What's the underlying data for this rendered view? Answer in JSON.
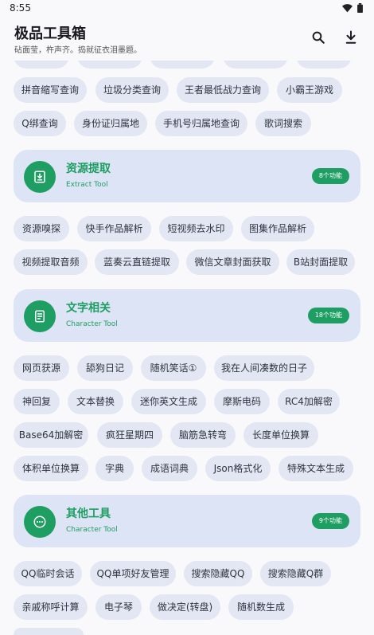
{
  "status": {
    "time": "8:55"
  },
  "app": {
    "title": "极品工具箱",
    "subtitle": "砧面莹，杵声齐。捣就征衣泪墨题。"
  },
  "colors": {
    "accent": "#1e9e62",
    "card_bg": "#dde4f6",
    "chip_bg": "#e3e7f3"
  },
  "sections": {
    "search": {
      "items": [
        "拼音缩写查询",
        "垃圾分类查询",
        "王者最低战力查询",
        "小霸王游戏",
        "Q绑查询",
        "身份证归属地",
        "手机号归属地查询",
        "歌词搜索"
      ]
    },
    "extract": {
      "title": "资源提取",
      "subtitle": "Extract Tool",
      "badge": "8个功能",
      "icon": "download-box-icon",
      "items": [
        "资源嗅探",
        "快手作品解析",
        "短视频去水印",
        "图集作品解析",
        "视频提取音频",
        "蓝奏云直链提取",
        "微信文章封面获取",
        "B站封面提取"
      ]
    },
    "character": {
      "title": "文字相关",
      "subtitle": "Character Tool",
      "badge": "18个功能",
      "icon": "document-icon",
      "items": [
        "网页获源",
        "舔狗日记",
        "随机笑话①",
        "我在人间凑数的日子",
        "神回复",
        "文本替换",
        "迷你英文生成",
        "摩斯电码",
        "RC4加解密",
        "Base64加解密",
        "疯狂星期四",
        "脑筋急转弯",
        "长度单位换算",
        "体积单位换算",
        "字典",
        "成语词典",
        "Json格式化",
        "特殊文本生成"
      ]
    },
    "other": {
      "title": "其他工具",
      "subtitle": "Character Tool",
      "badge": "9个功能",
      "icon": "more-dots-icon",
      "items": [
        "QQ临时会话",
        "QQ单项好友管理",
        "搜索隐藏QQ",
        "搜索隐藏Q群",
        "亲戚称呼计算",
        "电子琴",
        "做决定(转盘)",
        "随机数生成"
      ]
    }
  }
}
